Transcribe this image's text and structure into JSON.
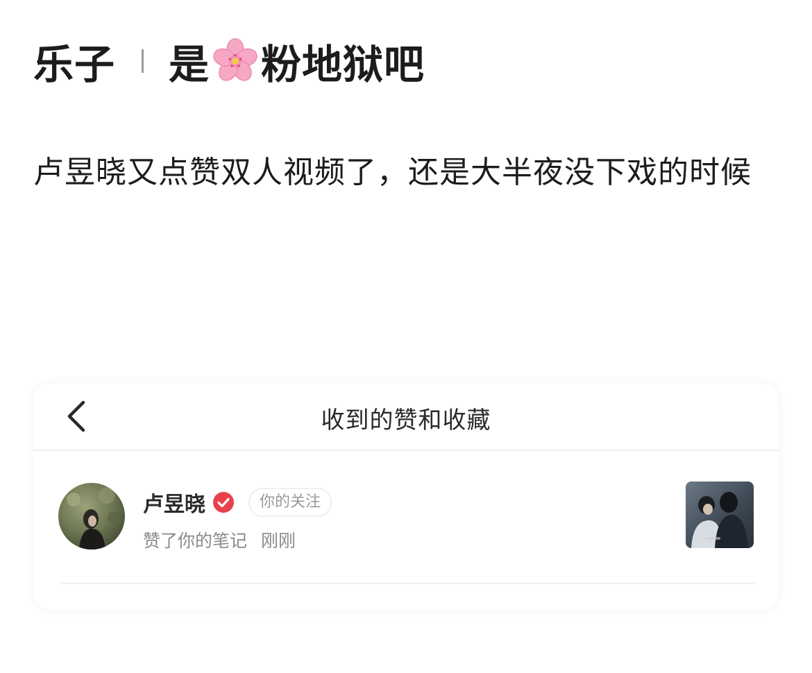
{
  "post": {
    "title_left": "乐子",
    "title_right": "粉地狱吧",
    "title_prefix": "是",
    "title_icon": "cherry-blossom-emoji",
    "body": "卢昱晓又点赞双人视频了，还是大半夜没下戏的时候"
  },
  "card": {
    "header_title": "收到的赞和收藏",
    "back_icon": "chevron-left-icon",
    "notification": {
      "user_name": "卢昱晓",
      "verified_icon": "verified-check-icon",
      "verified_color": "#e8414b",
      "follow_badge": "你的关注",
      "activity": "赞了你的笔记",
      "time": "刚刚"
    }
  }
}
